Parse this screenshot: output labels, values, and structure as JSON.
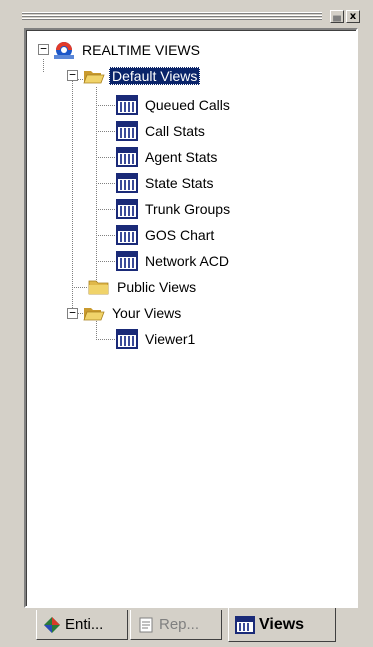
{
  "window": {
    "minimize_glyph": "▄",
    "close_glyph": "x"
  },
  "tree": {
    "expander_minus": "−",
    "expander_plus": "+",
    "root": {
      "label": "REALTIME VIEWS",
      "icon": "realtime-views-icon",
      "expanded": true
    },
    "default_views": {
      "label": "Default Views",
      "icon": "folder-open-icon",
      "selected": true,
      "expanded": true,
      "items": [
        {
          "label": "Queued Calls",
          "icon": "view-icon"
        },
        {
          "label": "Call Stats",
          "icon": "view-icon"
        },
        {
          "label": "Agent Stats",
          "icon": "view-icon"
        },
        {
          "label": "State Stats",
          "icon": "view-icon"
        },
        {
          "label": "Trunk Groups",
          "icon": "view-icon"
        },
        {
          "label": "GOS Chart",
          "icon": "view-icon"
        },
        {
          "label": "Network ACD",
          "icon": "view-icon"
        }
      ]
    },
    "public_views": {
      "label": "Public Views",
      "icon": "folder-closed-icon"
    },
    "your_views": {
      "label": "Your Views",
      "icon": "folder-open-icon",
      "expanded": true,
      "items": [
        {
          "label": "Viewer1",
          "icon": "view-icon"
        }
      ]
    }
  },
  "tabs": [
    {
      "label": "Enti...",
      "icon": "entities-diamond-icon",
      "active": false,
      "enabled": true
    },
    {
      "label": "Rep...",
      "icon": "reports-icon",
      "active": false,
      "enabled": false
    },
    {
      "label": "Views",
      "icon": "view-icon",
      "active": true,
      "enabled": true
    }
  ],
  "colors": {
    "selection": "#0a246a",
    "view_icon": "#1a2a78",
    "folder": "#e8c64a",
    "face": "#d4d0c8"
  }
}
